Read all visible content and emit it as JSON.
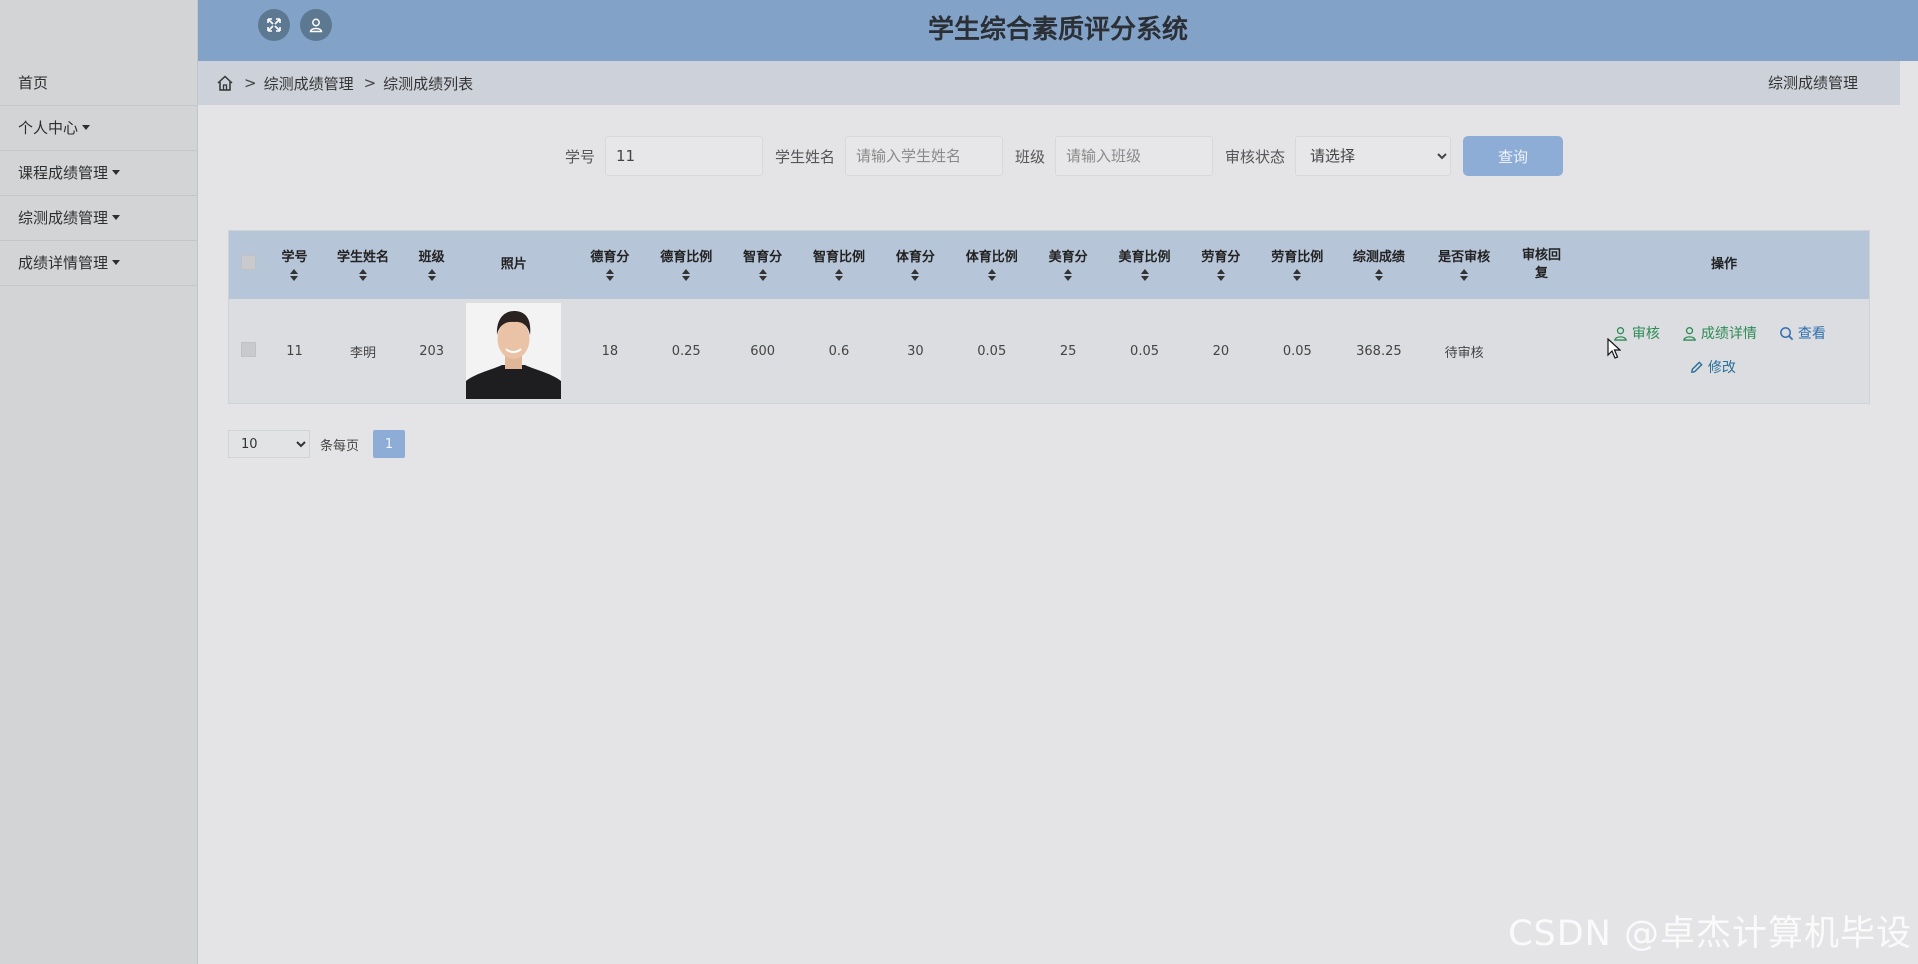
{
  "header": {
    "title": "学生综合素质评分系统",
    "buttons": [
      {
        "icon": "fullscreen-icon"
      },
      {
        "icon": "user-icon"
      }
    ]
  },
  "sidebar": {
    "items": [
      {
        "label": "首页",
        "has_caret": false
      },
      {
        "label": "个人中心",
        "has_caret": true
      },
      {
        "label": "课程成绩管理",
        "has_caret": true
      },
      {
        "label": "综测成绩管理",
        "has_caret": true
      },
      {
        "label": "成绩详情管理",
        "has_caret": true
      }
    ]
  },
  "breadcrumb": {
    "home_icon": "home-icon",
    "separator": ">",
    "items": [
      "综测成绩管理",
      "综测成绩列表"
    ],
    "right_label": "综测成绩管理"
  },
  "search": {
    "student_id_label": "学号",
    "student_id_value": "11",
    "student_name_label": "学生姓名",
    "student_name_placeholder": "请输入学生姓名",
    "class_label": "班级",
    "class_placeholder": "请输入班级",
    "review_status_label": "审核状态",
    "review_status_value": "请选择",
    "query_button": "查询"
  },
  "table": {
    "columns": [
      "学号",
      "学生姓名",
      "班级",
      "照片",
      "德育分",
      "德育比例",
      "智育分",
      "智育比例",
      "体育分",
      "体育比例",
      "美育分",
      "美育比例",
      "劳育分",
      "劳育比例",
      "综测成绩",
      "是否审核",
      "审核回复",
      "操作"
    ],
    "rows": [
      {
        "student_id": "11",
        "name": "李明",
        "class": "203",
        "moral_score": "18",
        "moral_ratio": "0.25",
        "intellect_score": "600",
        "intellect_ratio": "0.6",
        "sport_score": "30",
        "sport_ratio": "0.05",
        "art_score": "25",
        "art_ratio": "0.05",
        "labor_score": "20",
        "labor_ratio": "0.05",
        "total": "368.25",
        "review_status": "待审核",
        "review_reply": ""
      }
    ],
    "actions": {
      "review": "审核",
      "detail": "成绩详情",
      "view": "查看",
      "edit": "修改"
    }
  },
  "pagination": {
    "page_size": "10",
    "per_page_label": "条每页",
    "current_page": "1"
  },
  "watermark": "CSDN @卓杰计算机毕设",
  "colors": {
    "header_bg": "#83a2c7",
    "table_header_bg": "#b7c5d8",
    "button_bg": "#8eadd6",
    "action_green": "#2e8b57",
    "action_blue": "#2f6fb0"
  }
}
